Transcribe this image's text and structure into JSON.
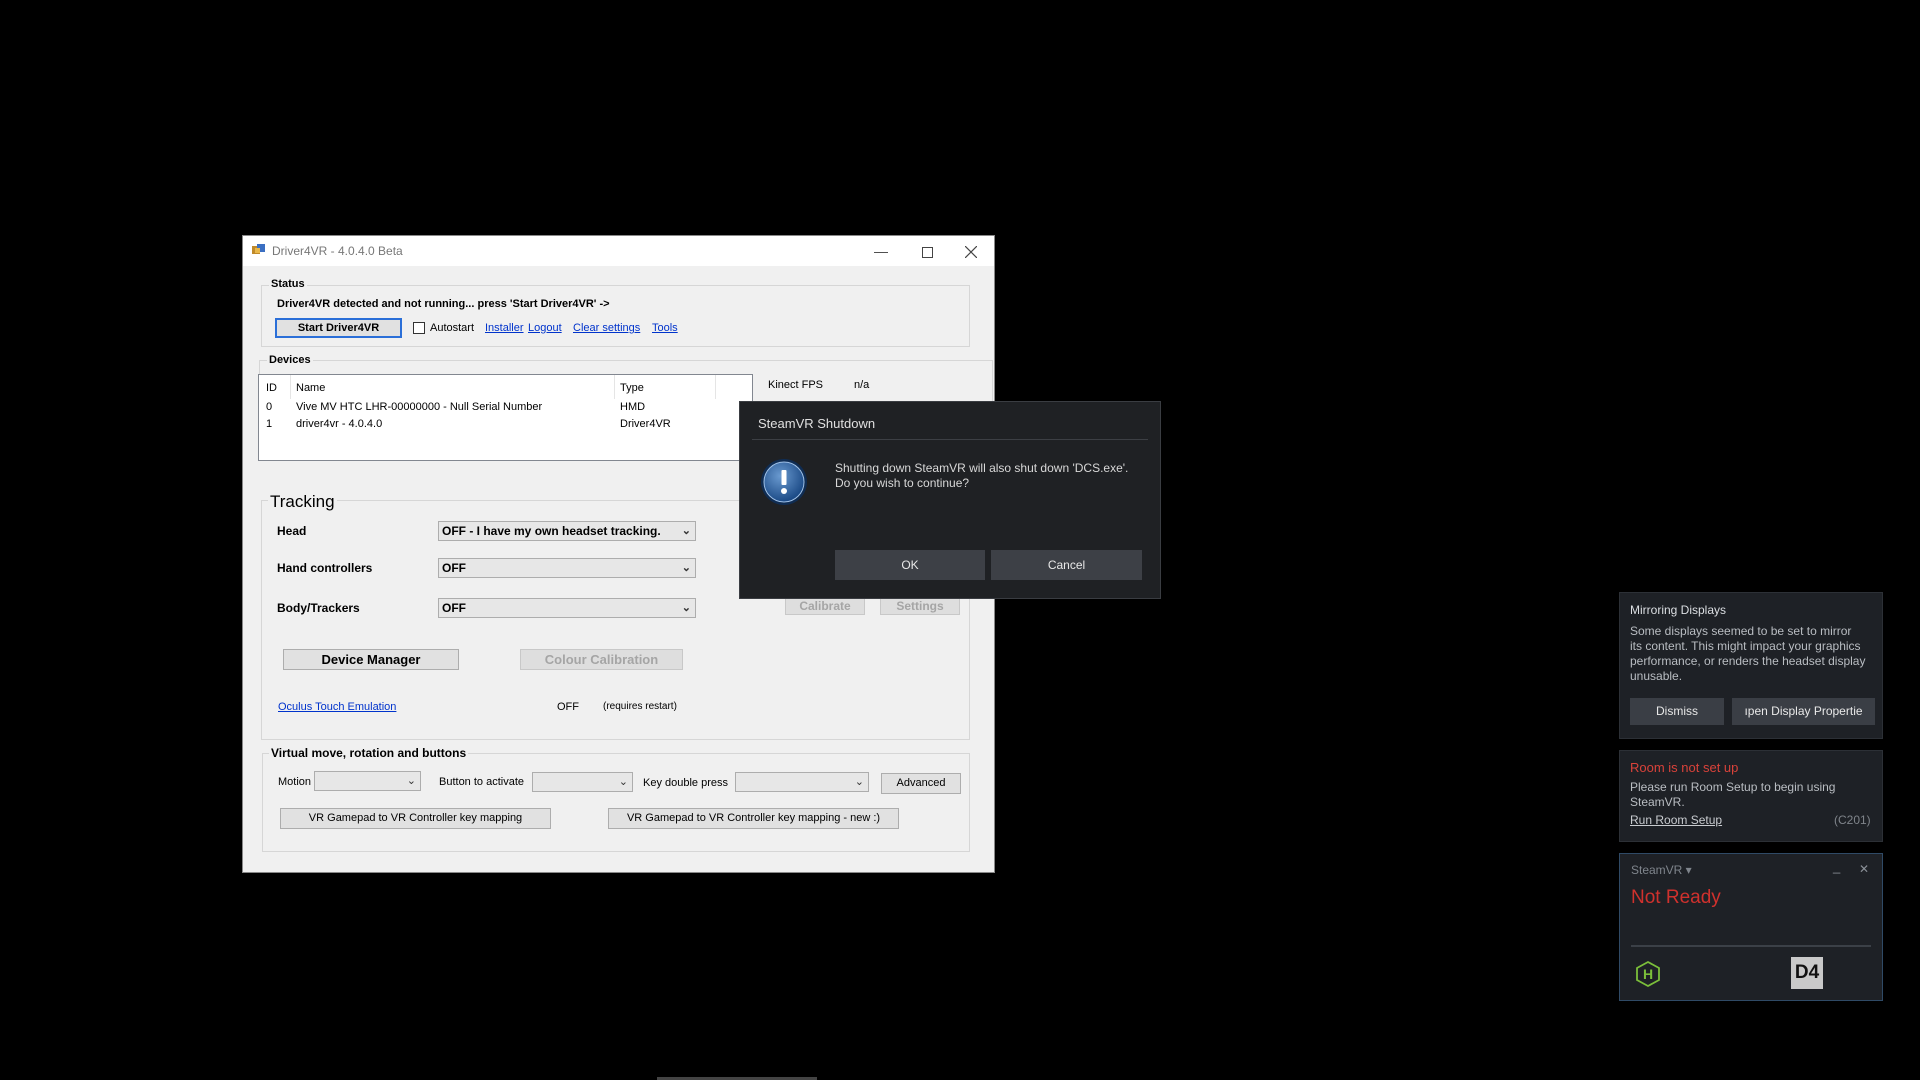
{
  "driver4vr": {
    "title": "Driver4VR - 4.0.4.0 Beta",
    "status": {
      "group_label": "Status",
      "message": "Driver4VR detected and not running... press 'Start Driver4VR' ->",
      "start_button": "Start Driver4VR",
      "autostart_label": "Autostart",
      "autostart_checked": false,
      "links": [
        "Installer",
        "Logout",
        "Clear settings",
        "Tools"
      ]
    },
    "devices": {
      "group_label": "Devices",
      "columns": [
        "ID",
        "Name",
        "Type"
      ],
      "rows": [
        {
          "id": "0",
          "name": "Vive MV HTC LHR-00000000 - Null Serial Number",
          "type": "HMD"
        },
        {
          "id": "1",
          "name": "driver4vr - 4.0.4.0",
          "type": "Driver4VR"
        }
      ],
      "kinect_fps_label": "Kinect FPS",
      "kinect_fps_value": "n/a"
    },
    "tracking": {
      "group_label": "Tracking",
      "head_label": "Head",
      "head_value": "OFF - I have my own headset tracking.",
      "hand_label": "Hand controllers",
      "hand_value": "OFF",
      "body_label": "Body/Trackers",
      "body_value": "OFF",
      "calibrate_button": "Calibrate",
      "settings_button": "Settings",
      "device_manager_button": "Device Manager",
      "colour_calibration_button": "Colour Calibration",
      "oculus_link": "Oculus Touch Emulation",
      "oculus_value": "OFF",
      "oculus_note": "(requires restart)"
    },
    "virtual": {
      "group_label": "Virtual move, rotation and buttons",
      "motion_label": "Motion",
      "motion_value": "",
      "button_activate_label": "Button to activate",
      "button_activate_value": "",
      "key_double_label": "Key double press",
      "key_double_value": "",
      "advanced_button": "Advanced",
      "gamepad_button": "VR Gamepad to VR Controller key mapping",
      "gamepad_new_button": "VR Gamepad to VR Controller key mapping - new :)"
    }
  },
  "steamvr_dialog": {
    "title": "SteamVR Shutdown",
    "line1": "Shutting down SteamVR will also shut down 'DCS.exe'.",
    "line2": "Do you wish to continue?",
    "ok": "OK",
    "cancel": "Cancel"
  },
  "notifications": {
    "mirroring": {
      "title": "Mirroring Displays",
      "body_lines": [
        "Some displays seemed to be set to mirror",
        "its content. This might impact your graphics",
        "performance, or renders the headset display",
        "unusable."
      ],
      "dismiss": "Dismiss",
      "open_display": "ıpen Display Propertie"
    },
    "room": {
      "title": "Room is not set up",
      "body_lines": [
        "Please run Room Setup to begin using",
        "SteamVR."
      ],
      "link": "Run Room Setup",
      "code": "(C201)"
    },
    "steamvr": {
      "title": "SteamVR ▾",
      "status": "Not Ready",
      "minimize": "_",
      "close": "✕",
      "hmd_icon_letter": "H",
      "d4_badge": "D4"
    }
  },
  "colors": {
    "not_ready_red": "#d0312d",
    "room_title_red": "#d9423a",
    "hmd_green": "#7bbf3a"
  }
}
